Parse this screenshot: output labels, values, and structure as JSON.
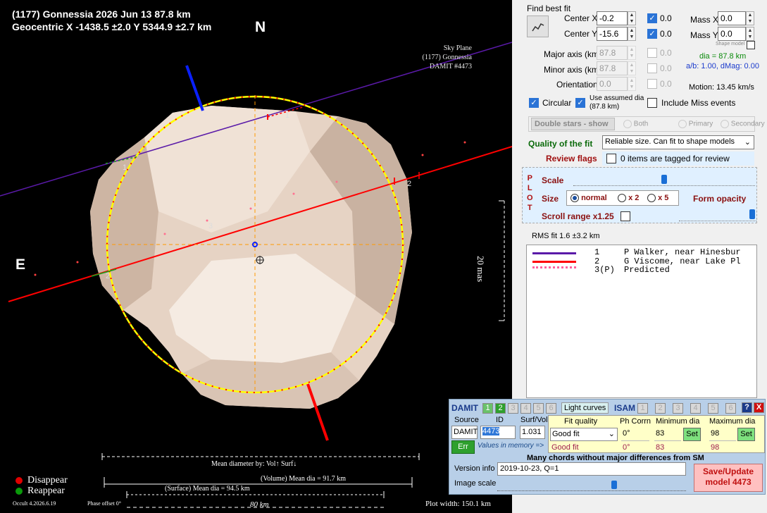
{
  "plot": {
    "title_line1": "(1177) Gonnessia  2026 Jun 13  87.8 km",
    "title_line2": "Geocentric X -1438.5 ±2.0  Y 5344.9 ±2.7 km",
    "north": "N",
    "east": "E",
    "sky_plane": [
      "Sky Plane",
      "(1177) Gonnessia",
      "DAMIT #4473"
    ],
    "chord_labels": [
      "1",
      "2",
      "1",
      "2",
      "3"
    ],
    "scale_text": "20 mas",
    "mean_diameter_title": "Mean diameter by: Vol↑ Surf↓",
    "volume_text": "(Volume) Mean dia = 91.7 km",
    "surface_text": "(Surface) Mean dia = 94.5 km",
    "km_text": "80 km",
    "legend_disappear": "Disappear",
    "legend_reappear": "Reappear",
    "version": "Occult 4.2026.6.19",
    "phase": "Phase offset 0°",
    "plot_width": "Plot width: 150.1 km",
    "colors": {
      "disappear": "#e00000",
      "reappear": "#0a9a0a",
      "ellipse": "#ffff00",
      "chord1": "#5a1aa8",
      "chord2": "#ff0000"
    }
  },
  "panel": {
    "find_best_fit": "Find best fit",
    "center_x_label": "Center X",
    "center_x": "-0.2",
    "center_x_fix": "0.0",
    "center_y_label": "Center Y",
    "center_y": "-15.6",
    "center_y_fix": "0.0",
    "mass_x_label": "Mass X",
    "mass_x": "0.0",
    "mass_y_label": "Mass Y",
    "mass_y": "0.0",
    "shape_model": "Shape model",
    "major_label": "Major axis (km)",
    "major": "87.8",
    "major_fix": "0.0",
    "minor_label": "Minor axis (km)",
    "minor": "87.8",
    "minor_fix": "0.0",
    "orient_label": "Orientation",
    "orient": "0.0",
    "orient_fix": "0.0",
    "dia_text": "dia = 87.8 km",
    "ab_text": "a/b: 1.00, dMag: 0.00",
    "motion_text": "Motion: 13.45 km/s",
    "circular": "Circular",
    "use_assumed": "Use assumed dia (87.8 km)",
    "include_miss": "Include Miss events",
    "double_stars": "Double stars - show",
    "radio_both": "Both",
    "radio_primary": "Primary",
    "radio_secondary": "Secondary",
    "quality_label": "Quality of the fit",
    "quality_value": "Reliable size. Can fit to shape models",
    "review_label": "Review flags",
    "review_text": "0 items are tagged for review",
    "plot_letters": [
      "P",
      "L",
      "O",
      "T"
    ],
    "scale_label": "Scale",
    "size_label": "Size",
    "size_normal": "normal",
    "size_x2": "x 2",
    "size_x5": "x 5",
    "form_opacity": "Form opacity",
    "scroll_range": "Scroll range x1.25",
    "rms_fit": "RMS fit 1.6 ±3.2 km",
    "legend": [
      {
        "num": "1",
        "name": "P Walker, near Hinesbur"
      },
      {
        "num": "2",
        "name": "G Viscome, near Lake Pl"
      },
      {
        "num": "3(P)",
        "name": "Predicted"
      }
    ]
  },
  "damit": {
    "title": "DAMIT",
    "nums": [
      "1",
      "2",
      "3",
      "4",
      "5",
      "6"
    ],
    "light_curves": "Light curves",
    "isam": "ISAM",
    "isam_nums": [
      "1",
      "2",
      "3",
      "4",
      "5",
      "6"
    ],
    "help": "?",
    "close": "X",
    "source_h": "Source",
    "id_h": "ID",
    "surfvol_h": "Surf/Vol",
    "fit_h": "Fit quality",
    "phcorr_h": "Ph Corrn",
    "mindia_h": "Minimum dia",
    "maxdia_h": "Maximum dia",
    "source": "DAMIT",
    "id": "4473",
    "surfvol": "1.031",
    "fit": "Good fit",
    "phcorr": "0°",
    "mindia": "83",
    "maxdia": "98",
    "set1": "Set",
    "set2": "Set",
    "err": "Err",
    "values_mem": "Values in memory =>",
    "fit_mem": "Good fit",
    "phcorr_mem": "0°",
    "mindia_mem": "83",
    "maxdia_mem": "98",
    "message": "Many chords without major differences from SM",
    "version_label": "Version info",
    "version_value": "2019-10-23, Q=1",
    "image_scale": "Image scale",
    "save_update": "Save/Update model 4473"
  }
}
